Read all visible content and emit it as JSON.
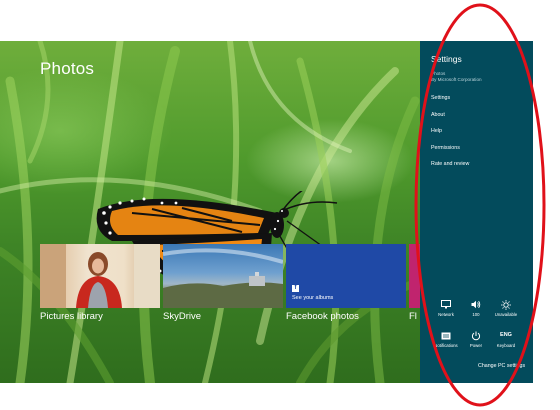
{
  "app": {
    "title": "Photos",
    "tiles": [
      {
        "label": "Pictures library"
      },
      {
        "label": "SkyDrive"
      },
      {
        "label": "Facebook photos",
        "caption": "See your albums",
        "icon_glyph": "f"
      },
      {
        "label": "Fl"
      }
    ]
  },
  "charm": {
    "title": "Settings",
    "app_name": "Photos",
    "publisher": "By Microsoft Corporation",
    "items": [
      {
        "label": "Settings"
      },
      {
        "label": "About"
      },
      {
        "label": "Help"
      },
      {
        "label": "Permissions"
      },
      {
        "label": "Rate and review"
      }
    ],
    "system": [
      {
        "label": "Network",
        "icon": "monitor-icon"
      },
      {
        "label": "100",
        "icon": "volume-icon"
      },
      {
        "label": "Unavailable",
        "icon": "brightness-icon"
      },
      {
        "label": "Notifications",
        "icon": "notifications-icon"
      },
      {
        "label": "Power",
        "icon": "power-icon",
        "glyph": "⏻"
      },
      {
        "label": "Keyboard",
        "icon": "keyboard-icon",
        "glyph": "ENG"
      }
    ],
    "change_pc_settings": "Change PC settings"
  },
  "colors": {
    "charm_background": "#034b5c",
    "facebook_tile": "#1f49a6",
    "annotation": "#e0111a"
  }
}
